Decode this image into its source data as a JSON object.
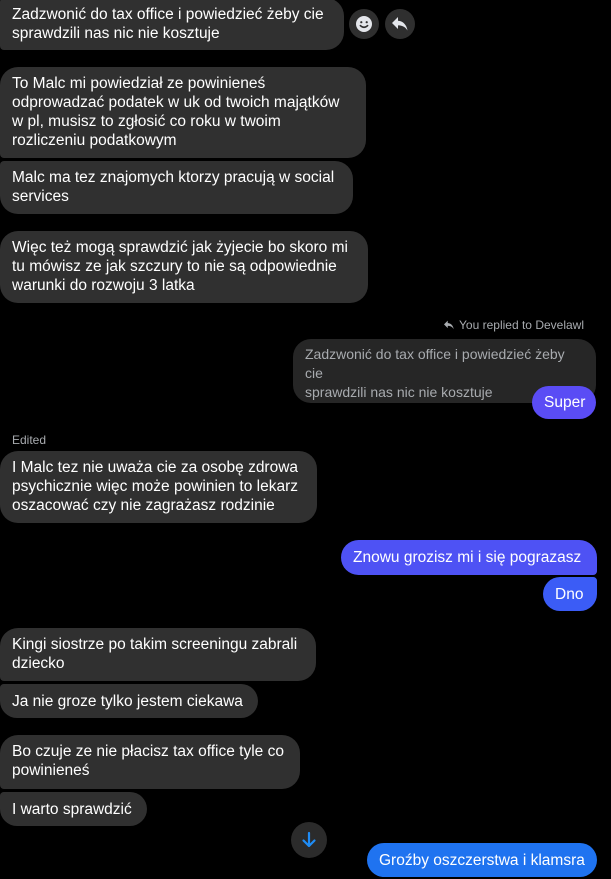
{
  "colors": {
    "background": "#000000",
    "incoming_bubble": "#303030",
    "outgoing_accent_purple": "#5a4cf5",
    "outgoing_accent_blue": "#3b5cf6",
    "outgoing_accent_lightblue": "#1f73f0",
    "quoted_bubble": "#262626",
    "muted_text": "#a8abaf"
  },
  "actions": {
    "react_icon": "smiley-icon",
    "reply_icon": "reply-icon",
    "scroll_down_icon": "arrow-down-icon"
  },
  "messages": {
    "m1": "Zadzwonić do tax office i powiedzieć żeby cie\nsprawdzili nas nic nie kosztuje",
    "m2": "To Malc mi powiedział ze powinieneś\nodprowadzać podatek w uk od twoich majątków\nw pl, musisz to zgłosić co roku w twoim\nrozliczeniu podatkowym",
    "m3": "Malc ma tez znajomych ktorzy pracują w social\nservices",
    "m4": "Więc też mogą sprawdzić jak żyjecie bo skoro mi\ntu mówisz ze jak szczury to nie są odpowiednie\nwarunki do rozwoju 3 latka",
    "reply_note": "You replied to Develawl",
    "quoted": "Zadzwonić do tax office i powiedzieć żeby cie\nsprawdzili nas nic nie kosztuje",
    "out1": "Super",
    "edited_label": "Edited",
    "m5": "I Malc tez nie uważa cie za osobę zdrowa\npsychicznie więc może powinien to lekarz\noszacować czy nie zagrażasz rodzinie",
    "out2": "Znowu grozisz mi i się pograzasz",
    "out3": "Dno",
    "m6": "Kingi siostrze po takim screeningu zabrali\ndziecko",
    "m7": "Ja nie groze tylko jestem ciekawa",
    "m8": "Bo czuje ze nie płacisz tax office tyle co\npowinieneś",
    "m9": "I warto sprawdzić",
    "out4": "Groźby oszczerstwa i klamsra"
  }
}
